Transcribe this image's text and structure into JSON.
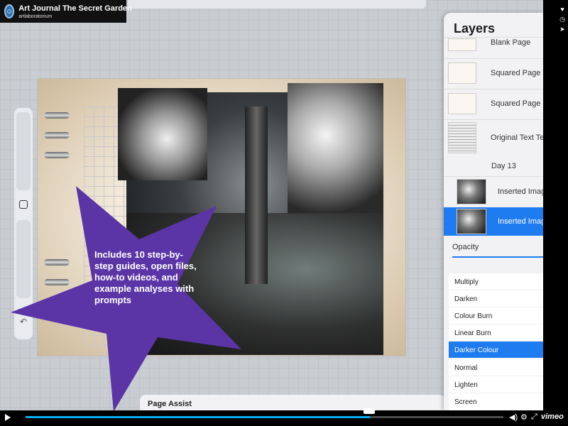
{
  "video": {
    "title": "Art Journal The Secret Garden",
    "channel": "artlaboratorium",
    "brand": "vimeo",
    "progress_fraction": 0.72,
    "loaded_fraction": 0.72
  },
  "promo": {
    "text": "Includes 10 step-by-step guides, open files, how-to videos, and example analyses with prompts",
    "star_color": "#5b35a6"
  },
  "layers_panel": {
    "title": "Layers",
    "items": [
      {
        "label": "Blank Page",
        "thumb": "paper"
      },
      {
        "label": "Squared Page",
        "thumb": "paper"
      },
      {
        "label": "Squared Page 2",
        "thumb": "paper"
      },
      {
        "label": "Original Text Te",
        "thumb": "text"
      },
      {
        "label": "Day 13",
        "thumb": "group"
      },
      {
        "label": "Inserted Imag",
        "thumb": "dark"
      },
      {
        "label": "Inserted Imag",
        "thumb": "dark",
        "selected": true
      }
    ],
    "opacity_label": "Opacity",
    "blend_modes": [
      "Multiply",
      "Darken",
      "Colour Burn",
      "Linear Burn",
      "Darker Colour",
      "Normal",
      "Lighten",
      "Screen"
    ],
    "active_blend_mode": "Darker Colour",
    "accent_color": "#1f7cf0"
  },
  "page_assist": {
    "label": "Page Assist"
  },
  "icons": {
    "heart": "heart-icon",
    "clock": "clock-icon",
    "share": "share-icon",
    "volume": "volume-icon",
    "settings": "gear-icon",
    "fullscreen": "fullscreen-icon",
    "play": "play-icon"
  }
}
